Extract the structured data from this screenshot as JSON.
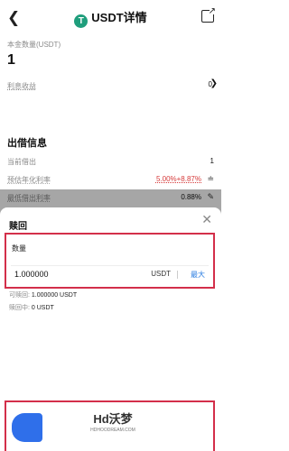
{
  "header": {
    "back_icon": "chevron-left-icon",
    "title": "USDT详情",
    "logo_char": "T",
    "share_icon": "share-icon"
  },
  "summary": {
    "principal_label": "本金数量(USDT)",
    "principal_value": "1",
    "interest_label": "利息收益",
    "interest_value": "0"
  },
  "lending": {
    "section_title": "出借信息",
    "rows": [
      {
        "label": "当前借出",
        "value": "1"
      },
      {
        "label": "预估年化利率",
        "value": "5.00%+8.87%"
      },
      {
        "label": "最低借出利率",
        "value": "0.88%"
      }
    ]
  },
  "sheet": {
    "title": "赎回",
    "amount_label": "数量",
    "amount_value": "1.000000",
    "amount_unit": "USDT",
    "max_label": "最大",
    "redeemable_label": "可赎回:",
    "redeemable_value": "1.000000 USDT",
    "redeeming_label": "赎回中:",
    "redeeming_value": "0 USDT"
  },
  "watermark": {
    "text": "Hd沃梦",
    "sub": "HDHOODREAM.COM"
  },
  "colors": {
    "accent_blue": "#2f6fea",
    "highlight_red": "#d32f4a",
    "rate_red": "#d63a3a",
    "usdt_green": "#1f9e7c"
  }
}
